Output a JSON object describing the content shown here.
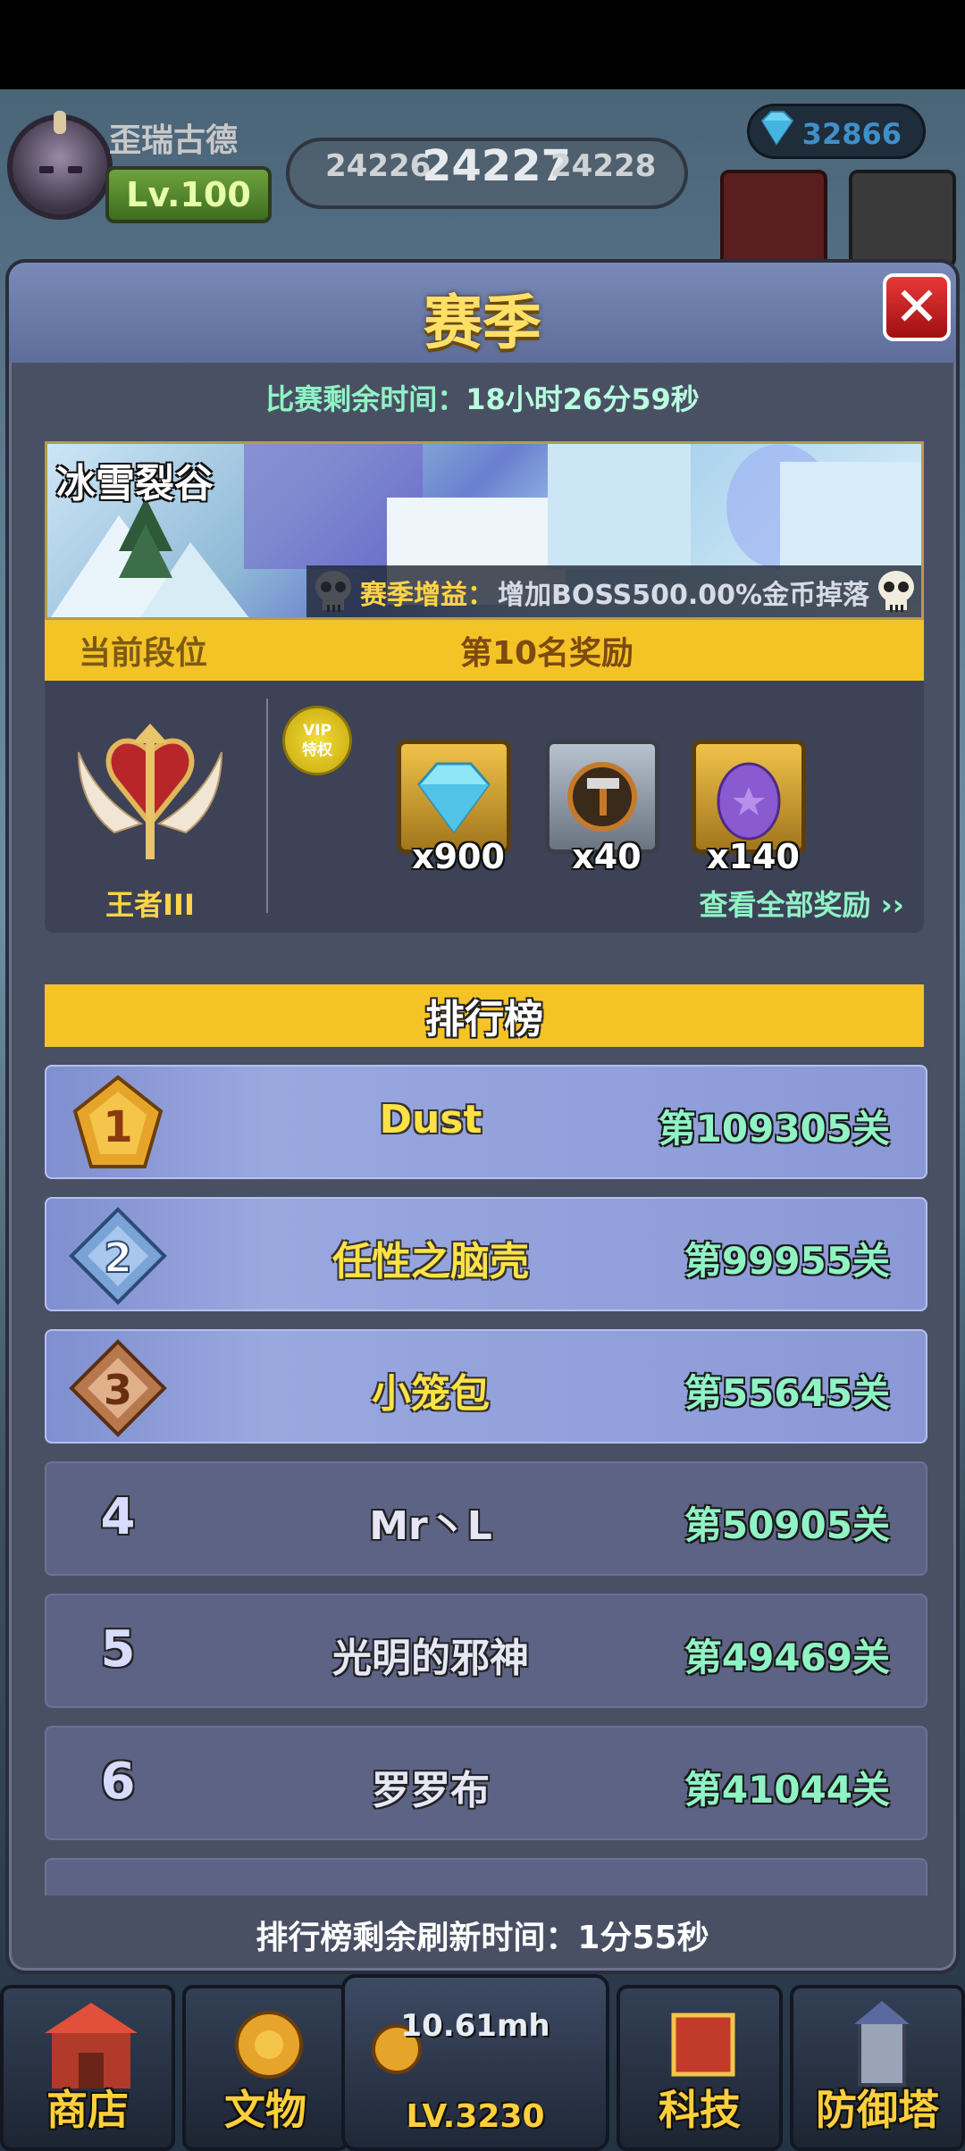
{
  "top": {
    "player_name": "歪瑞古德",
    "level": "Lv.100",
    "stage_prev": "24226",
    "stage_current": "24227",
    "stage_next": "24228",
    "gems": "32866"
  },
  "panel": {
    "title": "赛季",
    "close_label": "✕",
    "timer_label": "比赛剩余时间：",
    "timer_value": "18小时26分59秒",
    "banner_title": "冰雪裂谷",
    "bonus_label": "赛季增益：",
    "bonus_text": "增加BOSS500.00%金币掉落",
    "current_rank_label": "当前段位",
    "reward_label": "第10名奖励",
    "rank_name": "王者III",
    "vip_line1": "VIP",
    "vip_line2": "特权",
    "rewards": [
      {
        "icon": "diamond-icon",
        "qty": "x900"
      },
      {
        "icon": "hammer-icon",
        "qty": "x40"
      },
      {
        "icon": "egg-icon",
        "qty": "x140"
      }
    ],
    "view_all": "查看全部奖励 ››"
  },
  "leaderboard": {
    "title": "排行榜",
    "rows": [
      {
        "rank": "1",
        "name": "Dust",
        "level": "第109305关"
      },
      {
        "rank": "2",
        "name": "任性之脑壳",
        "level": "第99955关"
      },
      {
        "rank": "3",
        "name": "小笼包",
        "level": "第55645关"
      },
      {
        "rank": "4",
        "name": "Mr丶L",
        "level": "第50905关"
      },
      {
        "rank": "5",
        "name": "光明的邪神",
        "level": "第49469关"
      },
      {
        "rank": "6",
        "name": "罗罗布",
        "level": "第41044关"
      }
    ],
    "refresh_label": "排行榜剩余刷新时间：",
    "refresh_value": "1分55秒"
  },
  "bottom_nav": {
    "shop": "商店",
    "relics": "文物",
    "speed": "10.61mh",
    "center_level": "LV.3230",
    "tech": "科技",
    "tower": "防御塔"
  },
  "colors": {
    "accent_yellow": "#f4c326",
    "mint_text": "#8ff3c5",
    "panel_bg": "#4a5064",
    "close_red": "#e83838"
  }
}
